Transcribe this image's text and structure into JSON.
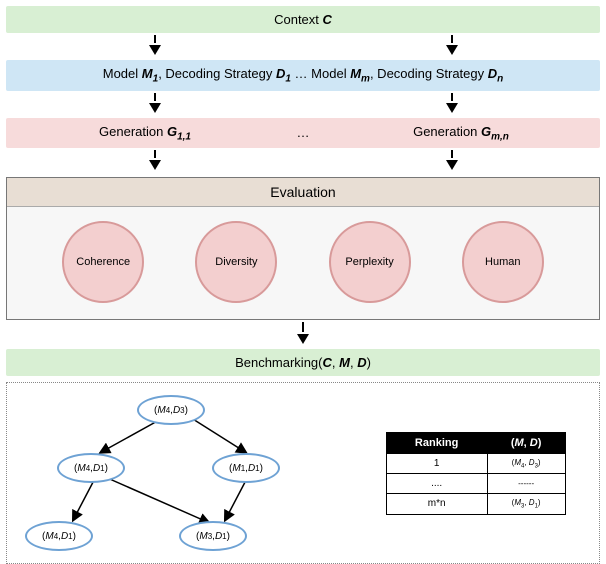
{
  "context_band": {
    "label_pre": "Context ",
    "label_bold": "C"
  },
  "model_band": {
    "left_pre": "Model ",
    "left_b": "M",
    "left_s1": "1",
    "left_mid": ", Decoding Strategy ",
    "left_b2": "D",
    "left_s2": "1",
    "ellipsis": " … ",
    "right_pre": "Model ",
    "right_b": "M",
    "right_s1": "m",
    "right_mid": ", Decoding Strategy ",
    "right_b2": "D",
    "right_s2": "n"
  },
  "gen_band": {
    "left_pre": "Generation ",
    "left_b": "G",
    "left_sub": "1,1",
    "ellipsis": "…",
    "right_pre": "Generation ",
    "right_b": "G",
    "right_sub": "m,n"
  },
  "evaluation": {
    "title": "Evaluation",
    "metrics": [
      "Coherence",
      "Diversity",
      "Perplexity",
      "Human"
    ]
  },
  "benchmark_band": {
    "pre": "Benchmarking(",
    "a": "C",
    "s1": ", ",
    "b": "M",
    "s2": ", ",
    "c": "D",
    "post": ")"
  },
  "graph_nodes": {
    "n0": {
      "m": "4",
      "d": "3"
    },
    "n1": {
      "m": "4",
      "d": "1"
    },
    "n2": {
      "m": "1",
      "d": "1"
    },
    "n3": {
      "m": "4",
      "d": "1"
    },
    "n4": {
      "m": "3",
      "d": "1"
    }
  },
  "ranking_table": {
    "h1": "Ranking",
    "h2_pre": "(",
    "h2_a": "M",
    "h2_s": ", ",
    "h2_b": "D",
    "h2_post": ")",
    "r1_rank": "1",
    "r1_m": "4",
    "r1_d": "3",
    "r2_rank": "....",
    "r2_val": "------",
    "r3_rank": "m*n",
    "r3_m": "3",
    "r3_d": "1"
  }
}
